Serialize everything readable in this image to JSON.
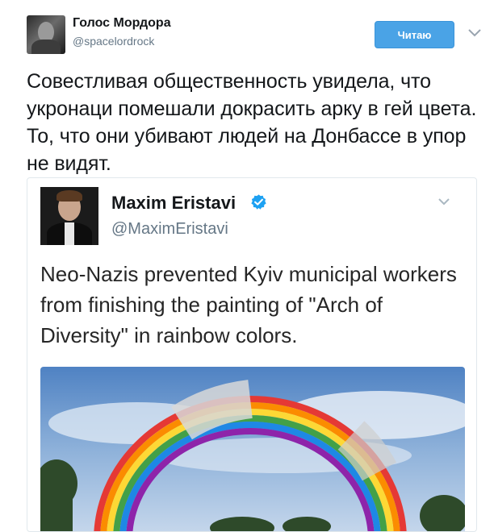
{
  "outer_tweet": {
    "author_name": "Голос Мордора",
    "author_handle": "@spacelordrock",
    "follow_label": "Читаю",
    "text": "Совестливая общественность увидела, что укронаци помешали докрасить арку в гей цвета. То, что они убивают людей на Донбассе в упор не видят."
  },
  "quoted_tweet": {
    "author_name": "Maxim Eristavi",
    "author_handle": "@MaximEristavi",
    "text": "Neo-Nazis prevented Kyiv municipal workers from finishing the painting of \"Arch of Diversity\" in rainbow colors."
  },
  "colors": {
    "follow_button": "#4aa3e6",
    "verified_badge": "#1da1f2",
    "name_text": "#14171a",
    "handle_text": "#657786"
  },
  "icons": {
    "follow_menu": "chevron-down-icon",
    "verified": "verified-badge-icon",
    "quote_menu": "chevron-down-icon"
  }
}
